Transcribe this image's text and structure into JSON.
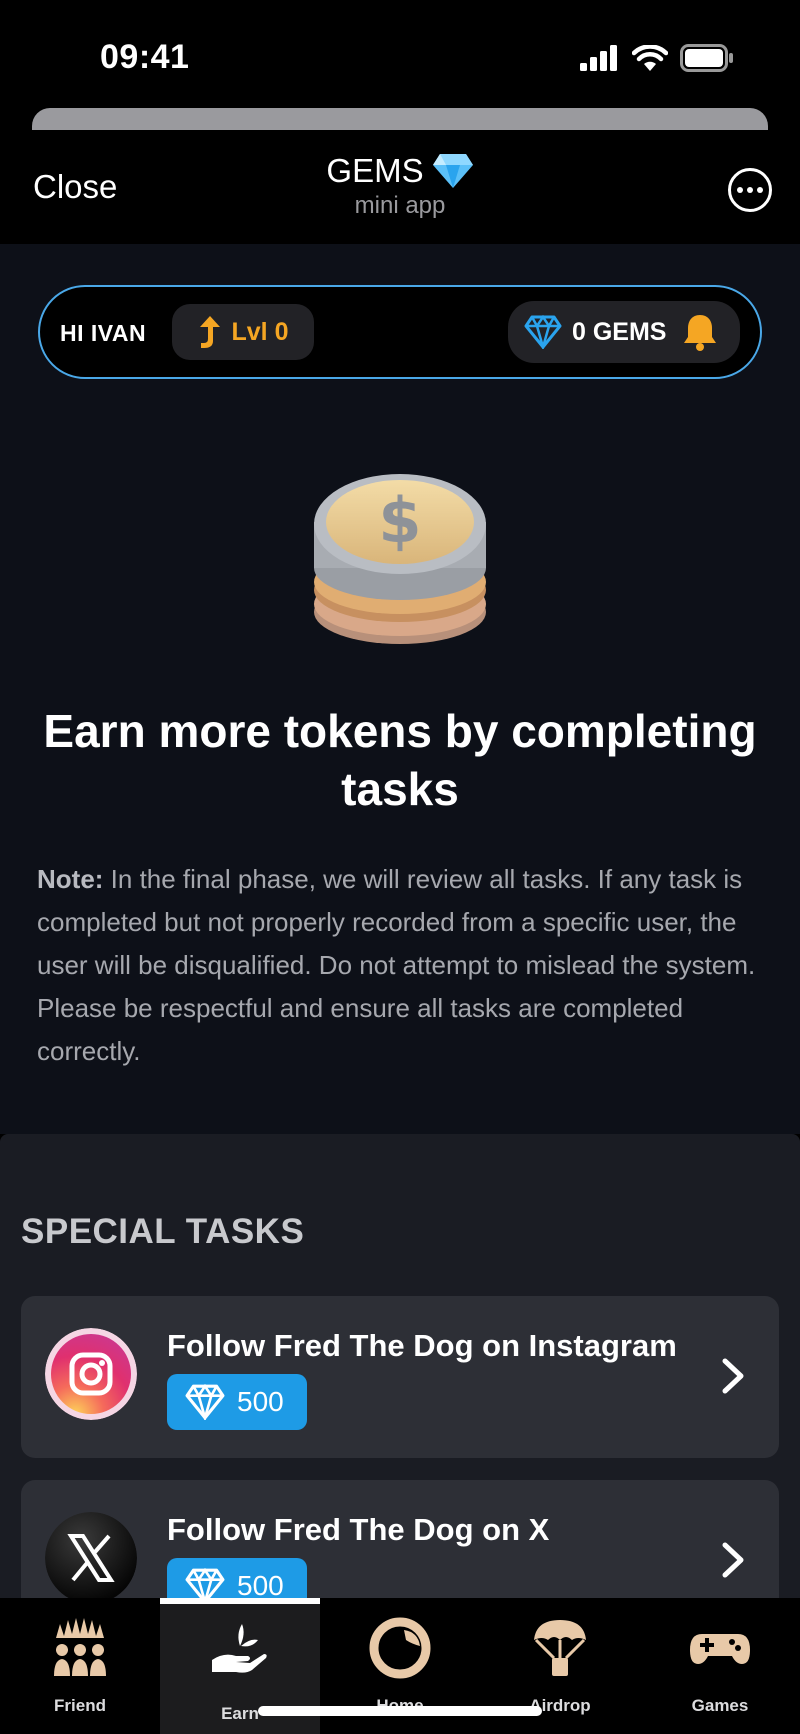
{
  "status_bar": {
    "time": "09:41"
  },
  "header": {
    "close_label": "Close",
    "title": "GEMS",
    "subtitle": "mini app"
  },
  "user_bar": {
    "greeting": "HI IVAN",
    "level": "Lvl 0",
    "gems": "0 GEMS"
  },
  "hero": {
    "title": "Earn more tokens by completing tasks"
  },
  "note": {
    "label": "Note:",
    "text": " In the final phase, we will review all tasks. If any task is completed but not properly recorded from a specific user, the user will be disqualified. Do not attempt to mislead the system. Please be respectful and ensure all tasks are completed correctly."
  },
  "tasks": {
    "section_title": "SPECIAL TASKS",
    "items": [
      {
        "title": "Follow Fred The Dog on Instagram",
        "reward": "500",
        "icon": "instagram-icon"
      },
      {
        "title": "Follow Fred The Dog on X",
        "reward": "500",
        "icon": "x-icon"
      }
    ]
  },
  "nav": {
    "items": [
      {
        "label": "Friend",
        "icon": "friends-icon"
      },
      {
        "label": "Earn",
        "icon": "earn-icon",
        "active": true
      },
      {
        "label": "Home",
        "icon": "home-icon"
      },
      {
        "label": "Airdrop",
        "icon": "airdrop-icon"
      },
      {
        "label": "Games",
        "icon": "gamepad-icon"
      }
    ]
  },
  "colors": {
    "accent_blue": "#1e9be6",
    "level_orange": "#f5a623",
    "border_blue": "#4aa8e8"
  }
}
